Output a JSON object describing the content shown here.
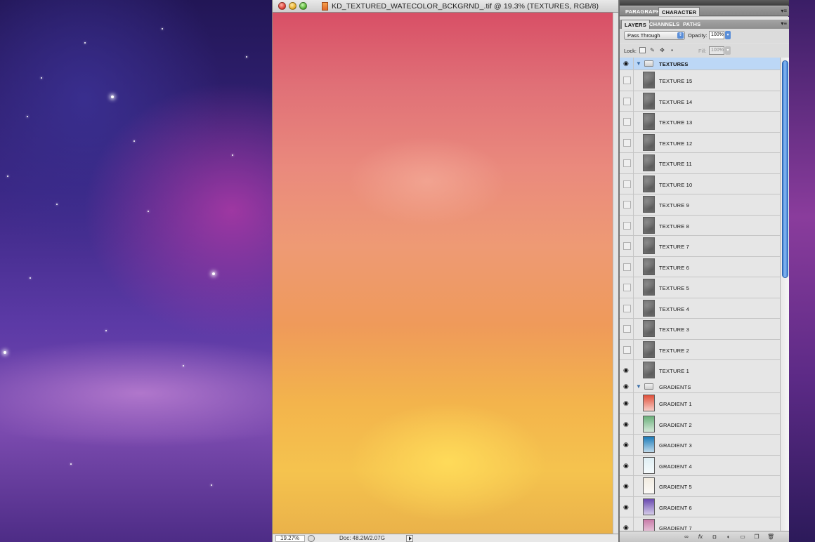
{
  "document": {
    "title": "KD_TEXTURED_WATECOLOR_BCKGRND_.tif @ 19.3% (TEXTURES, RGB/8)",
    "zoom_field": "19.27%",
    "doc_info": "Doc: 48.2M/2.07G"
  },
  "panels": {
    "top_tabs": [
      "PARAGRAPH",
      "CHARACTER"
    ],
    "layers_tabs": [
      "LAYERS",
      "CHANNELS",
      "PATHS"
    ],
    "blend_mode": "Pass Through",
    "opacity_label": "Opacity:",
    "opacity_value": "100%",
    "lock_label": "Lock:",
    "fill_label": "Fill:",
    "fill_value": "100%"
  },
  "layers": {
    "textures_group": "TEXTURES",
    "texture_layers": [
      "TEXTURE 15",
      "TEXTURE 14",
      "TEXTURE 13",
      "TEXTURE 12",
      "TEXTURE 11",
      "TEXTURE 10",
      "TEXTURE 9",
      "TEXTURE 8",
      "TEXTURE 7",
      "TEXTURE 6",
      "TEXTURE 5",
      "TEXTURE 4",
      "TEXTURE 3",
      "TEXTURE 2",
      "TEXTURE 1"
    ],
    "gradients_group": "GRADIENTS",
    "gradient_layers": [
      "GRADIENT 1",
      "GRADIENT 2",
      "GRADIENT 3",
      "GRADIENT 4",
      "GRADIENT 5",
      "GRADIENT 6",
      "GRADIENT 7"
    ],
    "gradient_thumb_colors": [
      "#e0503a",
      "#6ab07a",
      "#1a7ab8",
      "#dfeff4",
      "#f2ece0",
      "#6a4ab0",
      "#c87aa8"
    ],
    "selected_color": "#bcd7f6"
  }
}
